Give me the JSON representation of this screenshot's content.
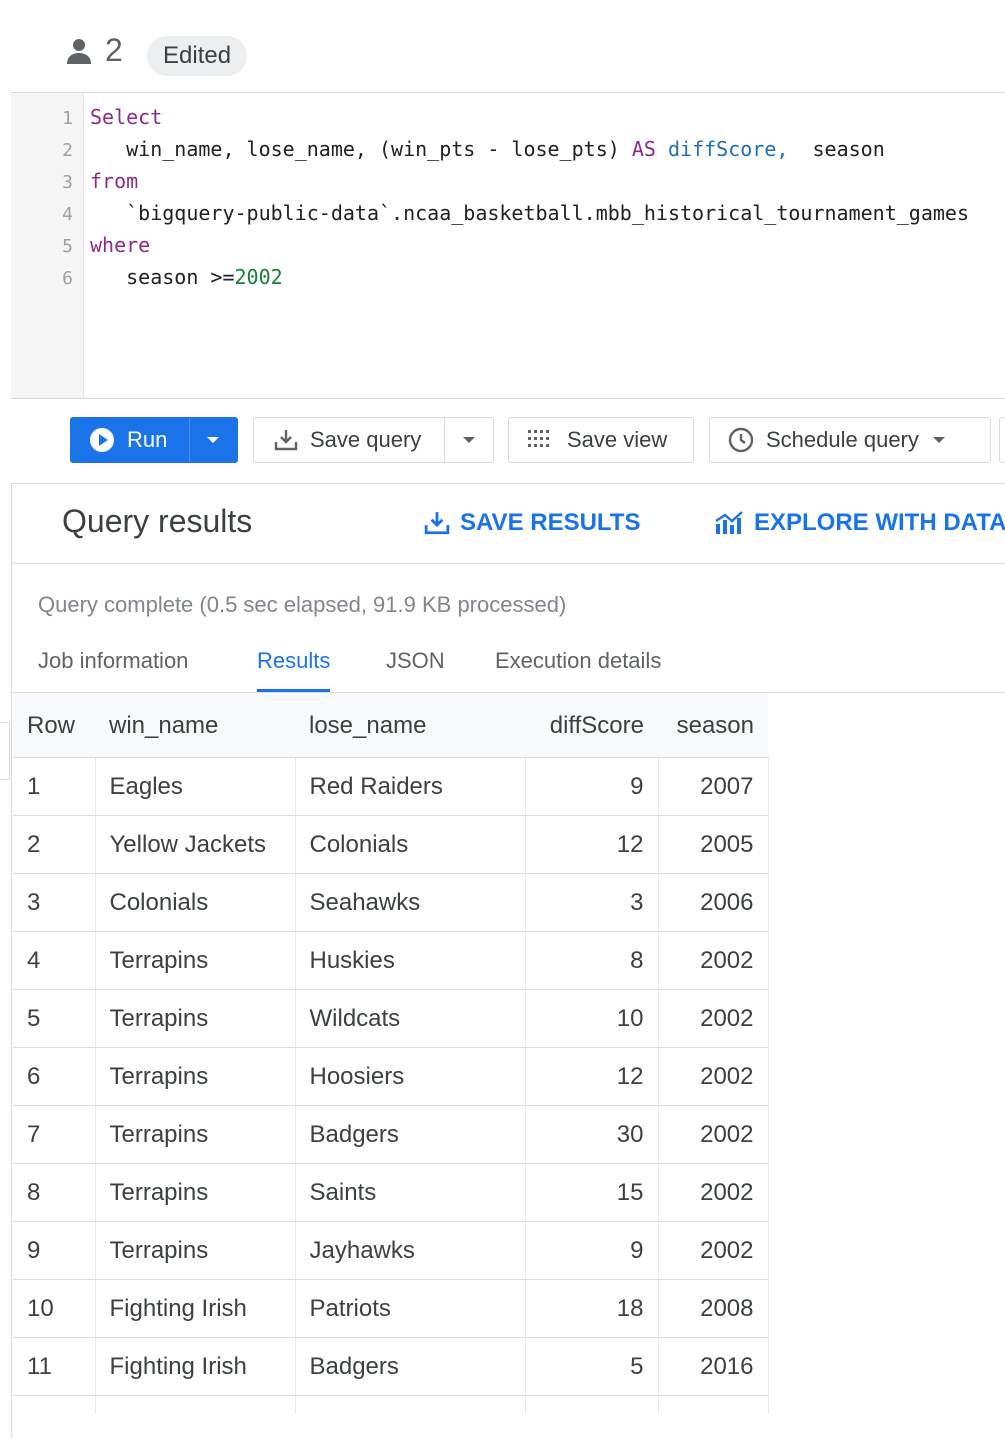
{
  "header": {
    "user_count": "2",
    "edited_label": "Edited"
  },
  "editor": {
    "lines": [
      {
        "num": "1",
        "tokens": [
          {
            "t": "Select",
            "c": "kw"
          }
        ]
      },
      {
        "num": "2",
        "tokens": [
          {
            "t": "   win_name, lose_name, (win_pts - lose_pts) ",
            "c": "pl"
          },
          {
            "t": "AS",
            "c": "kw"
          },
          {
            "t": " diffScore,",
            "c": "ty"
          },
          {
            "t": "  season",
            "c": "pl"
          }
        ]
      },
      {
        "num": "3",
        "tokens": [
          {
            "t": "from",
            "c": "kw"
          }
        ]
      },
      {
        "num": "4",
        "tokens": [
          {
            "t": "   `bigquery-public-data`.ncaa_basketball.mbb_historical_tournament_games",
            "c": "pl"
          }
        ]
      },
      {
        "num": "5",
        "tokens": [
          {
            "t": "where",
            "c": "kw"
          }
        ]
      },
      {
        "num": "6",
        "tokens": [
          {
            "t": "   season >=",
            "c": "pl"
          },
          {
            "t": "2002",
            "c": "nu"
          }
        ]
      }
    ]
  },
  "toolbar": {
    "run_label": "Run",
    "save_query_label": "Save query",
    "save_view_label": "Save view",
    "schedule_query_label": "Schedule query"
  },
  "results": {
    "title": "Query results",
    "save_results_label": "SAVE RESULTS",
    "explore_label": "EXPLORE WITH DATA",
    "status": "Query complete (0.5 sec elapsed, 91.9 KB processed)",
    "tabs": [
      "Job information",
      "Results",
      "JSON",
      "Execution details"
    ],
    "active_tab": "Results",
    "columns": [
      "Row",
      "win_name",
      "lose_name",
      "diffScore",
      "season"
    ],
    "rows": [
      [
        "1",
        "Eagles",
        "Red Raiders",
        "9",
        "2007"
      ],
      [
        "2",
        "Yellow Jackets",
        "Colonials",
        "12",
        "2005"
      ],
      [
        "3",
        "Colonials",
        "Seahawks",
        "3",
        "2006"
      ],
      [
        "4",
        "Terrapins",
        "Huskies",
        "8",
        "2002"
      ],
      [
        "5",
        "Terrapins",
        "Wildcats",
        "10",
        "2002"
      ],
      [
        "6",
        "Terrapins",
        "Hoosiers",
        "12",
        "2002"
      ],
      [
        "7",
        "Terrapins",
        "Badgers",
        "30",
        "2002"
      ],
      [
        "8",
        "Terrapins",
        "Saints",
        "15",
        "2002"
      ],
      [
        "9",
        "Terrapins",
        "Jayhawks",
        "9",
        "2002"
      ],
      [
        "10",
        "Fighting Irish",
        "Patriots",
        "18",
        "2008"
      ],
      [
        "11",
        "Fighting Irish",
        "Badgers",
        "5",
        "2016"
      ]
    ]
  },
  "colors": {
    "accent": "#1a73e8",
    "keyword": "#8b2b86",
    "identifier": "#1f6fb5",
    "number": "#188038"
  },
  "icons": {
    "users": "person-icon",
    "run": "play-circle-icon",
    "save": "download-tray-icon",
    "view": "grid-dots-icon",
    "schedule": "clock-icon",
    "explore": "chart-explore-icon"
  }
}
